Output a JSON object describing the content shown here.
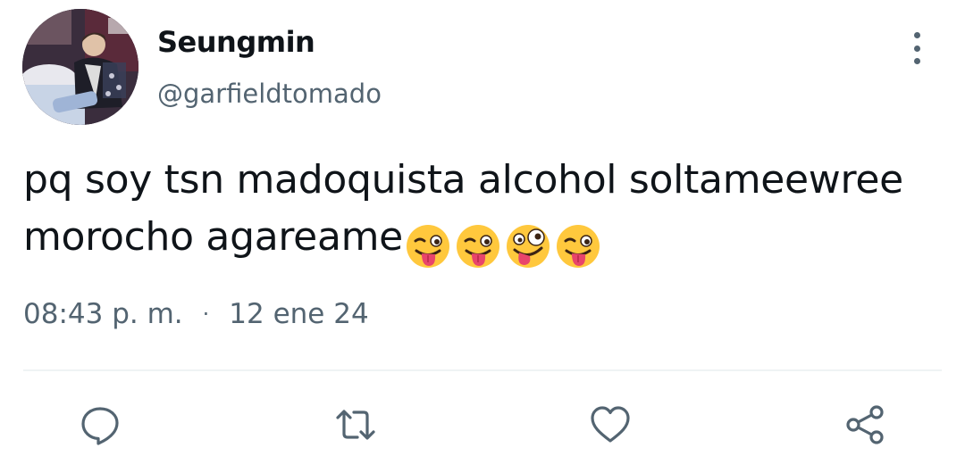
{
  "tweet": {
    "author": {
      "display_name": "Seungmin",
      "handle": "@garfieldtomado"
    },
    "text": "pq soy tsn madoquista alcohol soltameewree morocho agareame",
    "emojis": [
      "winking-face-with-tongue",
      "winking-face-with-tongue",
      "zany-face",
      "winking-face-with-tongue"
    ],
    "time": "08:43 p. m.",
    "separator": "·",
    "date": "12 ene 24"
  },
  "actions": {
    "icons": [
      "reply-icon",
      "retweet-icon",
      "like-icon",
      "share-icon"
    ]
  },
  "colors": {
    "text_primary": "#0f1419",
    "text_secondary": "#536471",
    "divider": "#eff3f4",
    "emoji_face": "#ffc83d",
    "emoji_tongue": "#e8456b"
  }
}
